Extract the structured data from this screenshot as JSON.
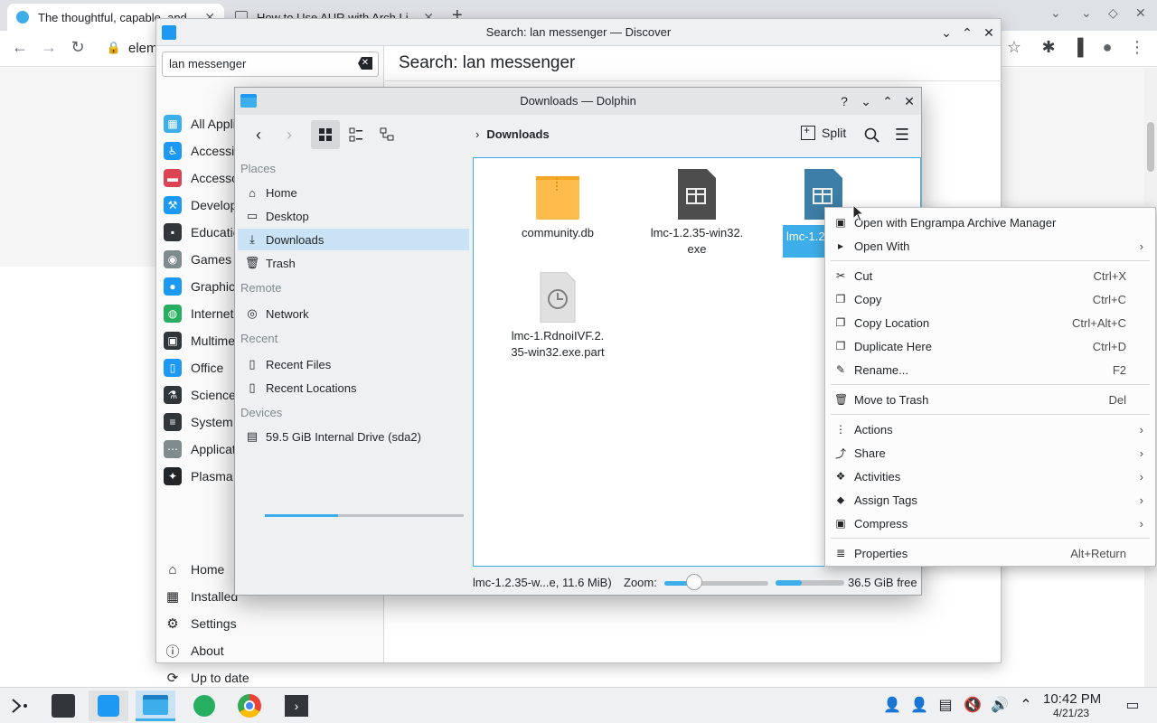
{
  "browser": {
    "tabs": [
      {
        "title": "The thoughtful, capable, and"
      },
      {
        "title": "How to Use AUR with Arch Li"
      }
    ],
    "address_text": "elem"
  },
  "discover": {
    "title": "Search: lan messenger — Discover",
    "search_value": "lan messenger",
    "main_title": "Search: lan messenger",
    "categories": [
      {
        "label": "All Applications",
        "color": "#3daee9",
        "icon": "grid-icon"
      },
      {
        "label": "Accessibility",
        "color": "#1d99f3",
        "icon": "accessibility-icon"
      },
      {
        "label": "Accessories",
        "color": "#da4453",
        "icon": "toolbox-icon"
      },
      {
        "label": "Development",
        "color": "#1d99f3",
        "icon": "hammer-icon"
      },
      {
        "label": "Education",
        "color": "#31363b",
        "icon": "blackboard-icon"
      },
      {
        "label": "Games",
        "color": "#7f8c8d",
        "icon": "gamepad-icon"
      },
      {
        "label": "Graphics",
        "color": "#1d99f3",
        "icon": "palette-icon"
      },
      {
        "label": "Internet",
        "color": "#27ae60",
        "icon": "globe-icon"
      },
      {
        "label": "Multimedia",
        "color": "#31363b",
        "icon": "monitor-icon"
      },
      {
        "label": "Office",
        "color": "#1d99f3",
        "icon": "document-icon"
      },
      {
        "label": "Science",
        "color": "#31363b",
        "icon": "flask-icon"
      },
      {
        "label": "System Settings",
        "color": "#31363b",
        "icon": "sliders-icon"
      },
      {
        "label": "Application Addons",
        "color": "#7f8c8d",
        "icon": "dots-icon"
      },
      {
        "label": "Plasma Addons",
        "color": "#232629",
        "icon": "plasma-icon"
      }
    ],
    "bottom_nav": [
      {
        "label": "Home",
        "icon": "home-icon"
      },
      {
        "label": "Installed",
        "icon": "installed-icon"
      },
      {
        "label": "Settings",
        "icon": "settings-icon"
      },
      {
        "label": "About",
        "icon": "info-icon"
      },
      {
        "label": "Up to date",
        "icon": "update-icon"
      }
    ]
  },
  "dolphin": {
    "title": "Downloads — Dolphin",
    "breadcrumb": "Downloads",
    "split_label": "Split",
    "places": {
      "places_heading": "Places",
      "home": "Home",
      "desktop": "Desktop",
      "downloads": "Downloads",
      "trash": "Trash",
      "remote_heading": "Remote",
      "network": "Network",
      "recent_heading": "Recent",
      "recent_files": "Recent Files",
      "recent_locations": "Recent Locations",
      "devices_heading": "Devices",
      "drive": "59.5 GiB Internal Drive (sda2)"
    },
    "drive_usage_fraction": 0.37,
    "files": [
      {
        "name": "community.db",
        "type": "archive"
      },
      {
        "name": "lmc-1.2.35-win32.\nexe",
        "type": "exe"
      },
      {
        "name": "lmc-1.2",
        "type": "exe-selected"
      },
      {
        "name": "lmc-1.RdnoiIVF.2.\n35-win32.exe.part",
        "type": "partial"
      }
    ],
    "status_text": "lmc-1.2.35-w...e, 11.6 MiB)",
    "zoom_label": "Zoom:",
    "zoom_fraction": 0.28,
    "free_space": "36.5 GiB free",
    "free_space_used_fraction": 0.38
  },
  "context_menu": {
    "items": [
      {
        "label": "Open with Engrampa Archive Manager",
        "shortcut": "",
        "submenu": false,
        "icon": "archive-icon"
      },
      {
        "label": "Open With",
        "shortcut": "",
        "submenu": true,
        "icon": "open-with-icon"
      },
      {
        "label": "Cut",
        "shortcut": "Ctrl+X",
        "submenu": false,
        "icon": "scissors-icon"
      },
      {
        "label": "Copy",
        "shortcut": "Ctrl+C",
        "submenu": false,
        "icon": "copy-icon"
      },
      {
        "label": "Copy Location",
        "shortcut": "Ctrl+Alt+C",
        "submenu": false,
        "icon": "copy-location-icon"
      },
      {
        "label": "Duplicate Here",
        "shortcut": "Ctrl+D",
        "submenu": false,
        "icon": "duplicate-icon"
      },
      {
        "label": "Rename...",
        "shortcut": "F2",
        "submenu": false,
        "icon": "pencil-icon"
      },
      {
        "label": "Move to Trash",
        "shortcut": "Del",
        "submenu": false,
        "icon": "trash-icon"
      },
      {
        "label": "Actions",
        "shortcut": "",
        "submenu": true,
        "icon": "kebab-icon"
      },
      {
        "label": "Share",
        "shortcut": "",
        "submenu": true,
        "icon": "share-icon"
      },
      {
        "label": "Activities",
        "shortcut": "",
        "submenu": true,
        "icon": "activities-icon"
      },
      {
        "label": "Assign Tags",
        "shortcut": "",
        "submenu": true,
        "icon": "tag-icon"
      },
      {
        "label": "Compress",
        "shortcut": "",
        "submenu": true,
        "icon": "compress-icon"
      },
      {
        "label": "Properties",
        "shortcut": "Alt+Return",
        "submenu": false,
        "icon": "properties-icon"
      }
    ]
  },
  "taskbar": {
    "time": "10:42 PM",
    "date": "4/21/23"
  }
}
